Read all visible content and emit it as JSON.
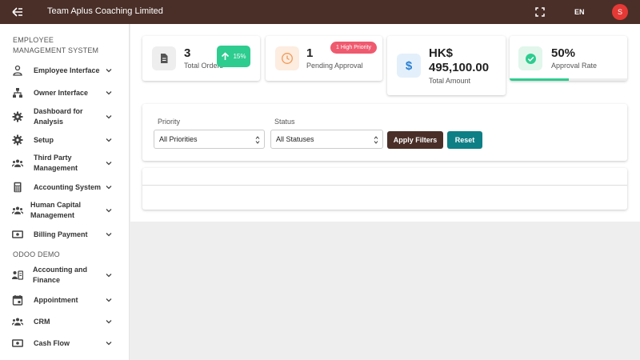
{
  "header": {
    "title": "Team Aplus Coaching Limited",
    "language": "EN",
    "avatar_initial": "S",
    "bg_color": "#4a2f28"
  },
  "sidebar": {
    "section1": "EMPLOYEE MANAGEMENT SYSTEM",
    "section2": "ODOO DEMO",
    "items": [
      {
        "label": "Employee Interface",
        "icon": "person-icon"
      },
      {
        "label": "Owner Interface",
        "icon": "org-chart-icon"
      },
      {
        "label": "Dashboard for Analysis",
        "icon": "gear-icon"
      },
      {
        "label": "Setup",
        "icon": "gear-icon"
      },
      {
        "label": "Third Party Management",
        "icon": "group-icon"
      },
      {
        "label": "Accounting System",
        "icon": "calculator-icon"
      },
      {
        "label": "Human Capital Management",
        "icon": "group-icon"
      },
      {
        "label": "Billing Payment",
        "icon": "money-icon"
      },
      {
        "label": "Accounting and Finance",
        "icon": "finance-icon"
      },
      {
        "label": "Appointment",
        "icon": "calendar-icon"
      },
      {
        "label": "CRM",
        "icon": "group-icon"
      },
      {
        "label": "Cash Flow",
        "icon": "money-icon"
      }
    ]
  },
  "stats": {
    "orders": {
      "value": "3",
      "label": "Total Orders",
      "badge": "15%"
    },
    "pending": {
      "value": "1",
      "label": "Pending Approval",
      "badge": "1 High Priority"
    },
    "amount": {
      "currency": "HK$",
      "value": "495,100.00",
      "label": "Total Amount"
    },
    "approval": {
      "value": "50%",
      "label": "Approval Rate",
      "progress": 0.5
    }
  },
  "filters": {
    "priority_label": "Priority",
    "priority_value": "All Priorities",
    "status_label": "Status",
    "status_value": "All Statuses",
    "apply_label": "Apply Filters",
    "reset_label": "Reset"
  },
  "colors": {
    "accent_green": "#2ecc8f",
    "badge_red": "#ef5a6f",
    "apply_btn": "#4a2f28",
    "reset_btn": "#0f7f86"
  }
}
